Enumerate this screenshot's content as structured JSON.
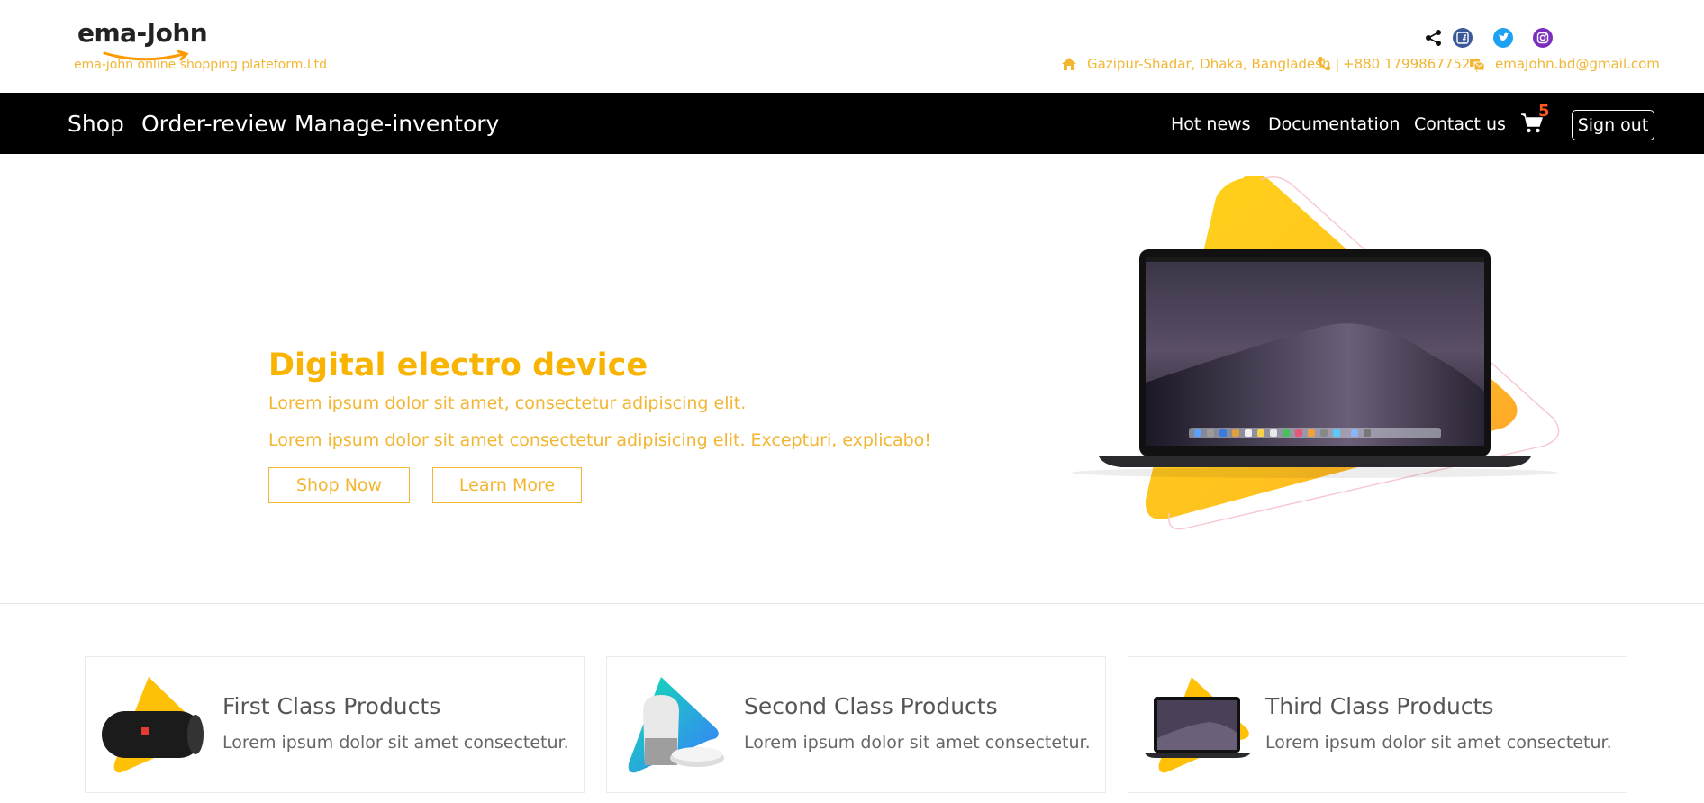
{
  "brand": {
    "logo_text": "ema-John",
    "tagline": "ema-john online shopping plateform.Ltd"
  },
  "social": {
    "icons": [
      "share-icon",
      "facebook-icon",
      "twitter-icon",
      "instagram-icon"
    ]
  },
  "contact": {
    "address": "Gazipur-Shadar, Dhaka, Bangladesh |",
    "phone": "+880 1799867752 |",
    "email": "emaJohn.bd@gmail.com"
  },
  "nav": {
    "left": [
      "Shop",
      "Order-review",
      "Manage-inventory"
    ],
    "right": [
      "Hot news",
      "Documentation",
      "Contact us"
    ],
    "cart_count": "5",
    "sign_out": "Sign out"
  },
  "hero": {
    "title": "Digital electro device",
    "line1": "Lorem ipsum dolor sit amet, consectetur adipiscing elit.",
    "line2": "Lorem ipsum dolor sit amet consectetur adipisicing elit. Excepturi, explicabo!",
    "shop_now": "Shop Now",
    "learn_more": "Learn More"
  },
  "cards": [
    {
      "title": "First Class Products",
      "text": "Lorem ipsum dolor sit amet consectetur."
    },
    {
      "title": "Second Class Products",
      "text": "Lorem ipsum dolor sit amet consectetur."
    },
    {
      "title": "Third Class Products",
      "text": "Lorem ipsum dolor sit amet consectetur."
    }
  ],
  "colors": {
    "accent": "#f2b632",
    "title_yellow": "#f8b400",
    "nav_bg": "#000000",
    "cart_badge": "#ff5722"
  }
}
